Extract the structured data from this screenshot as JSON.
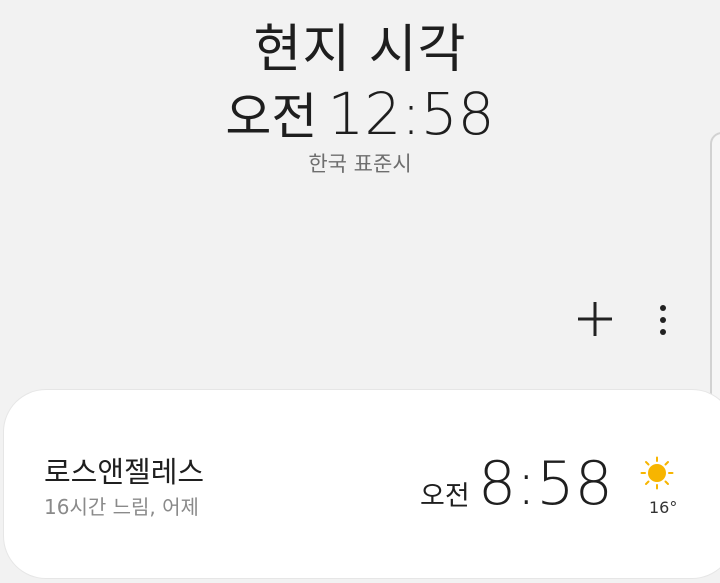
{
  "header": {
    "title": "현지 시각",
    "ampm": "오전",
    "time": "12:58",
    "timezone": "한국 표준시"
  },
  "toolbar": {
    "add_icon": "plus-icon",
    "more_icon": "more-vertical-icon"
  },
  "world_clock": {
    "items": [
      {
        "city": "로스앤젤레스",
        "difference": "16시간 느림, 어제",
        "ampm": "오전",
        "time": "8:58",
        "weather_icon": "sun-icon",
        "temperature": "16°"
      }
    ]
  },
  "colors": {
    "background": "#f2f2f2",
    "card": "#ffffff",
    "sun": "#f7b500"
  }
}
